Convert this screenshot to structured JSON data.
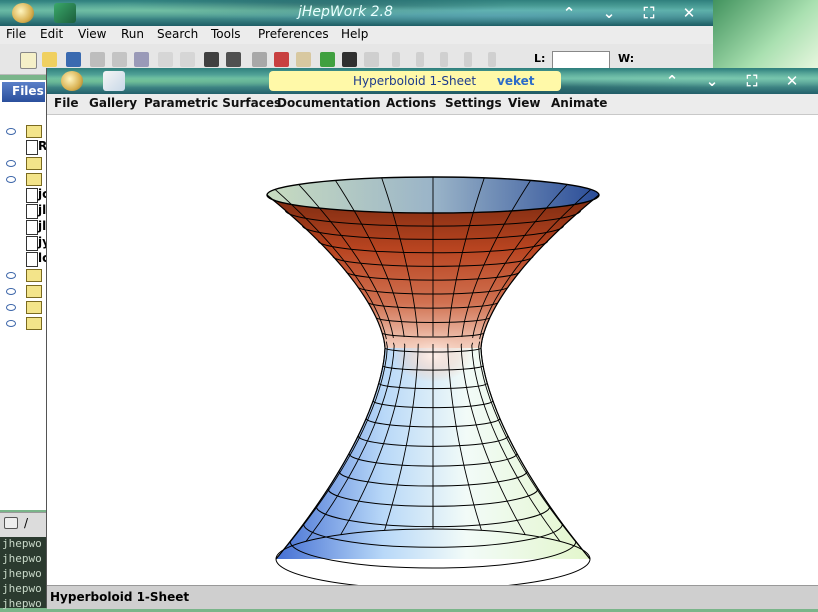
{
  "back_window": {
    "title": "jHepWork 2.8",
    "menu": [
      "File",
      "Edit",
      "View",
      "Run",
      "Search",
      "Tools",
      "Preferences",
      "Help"
    ],
    "toolbar_l_label": "L:",
    "toolbar_w_label": "W:",
    "files_tab_label": "Files",
    "tree_fragments": [
      "R",
      "jc",
      "jl",
      "jl",
      "jy",
      "lc"
    ],
    "bottom_tab_label": "/",
    "terminal_lines": [
      "jhepwo",
      "jhepwo",
      "jhepwo",
      "jhepwo",
      "jhepwo"
    ]
  },
  "front_window": {
    "title": "Hyperboloid 1-Sheet",
    "title_user": "veket",
    "menu": [
      "File",
      "Gallery",
      "Parametric Surfaces",
      "Documentation",
      "Actions",
      "Settings",
      "View",
      "Animate"
    ],
    "status": "Hyperboloid 1-Sheet"
  },
  "window_controls": [
    "shade",
    "minimize",
    "maximize",
    "close"
  ],
  "colors": {
    "title_pill": "#fff9a8",
    "inner_surface": "#b8401c",
    "outer_surface_blue": "#4a78d8",
    "outer_surface_light": "#e6f6e0"
  }
}
